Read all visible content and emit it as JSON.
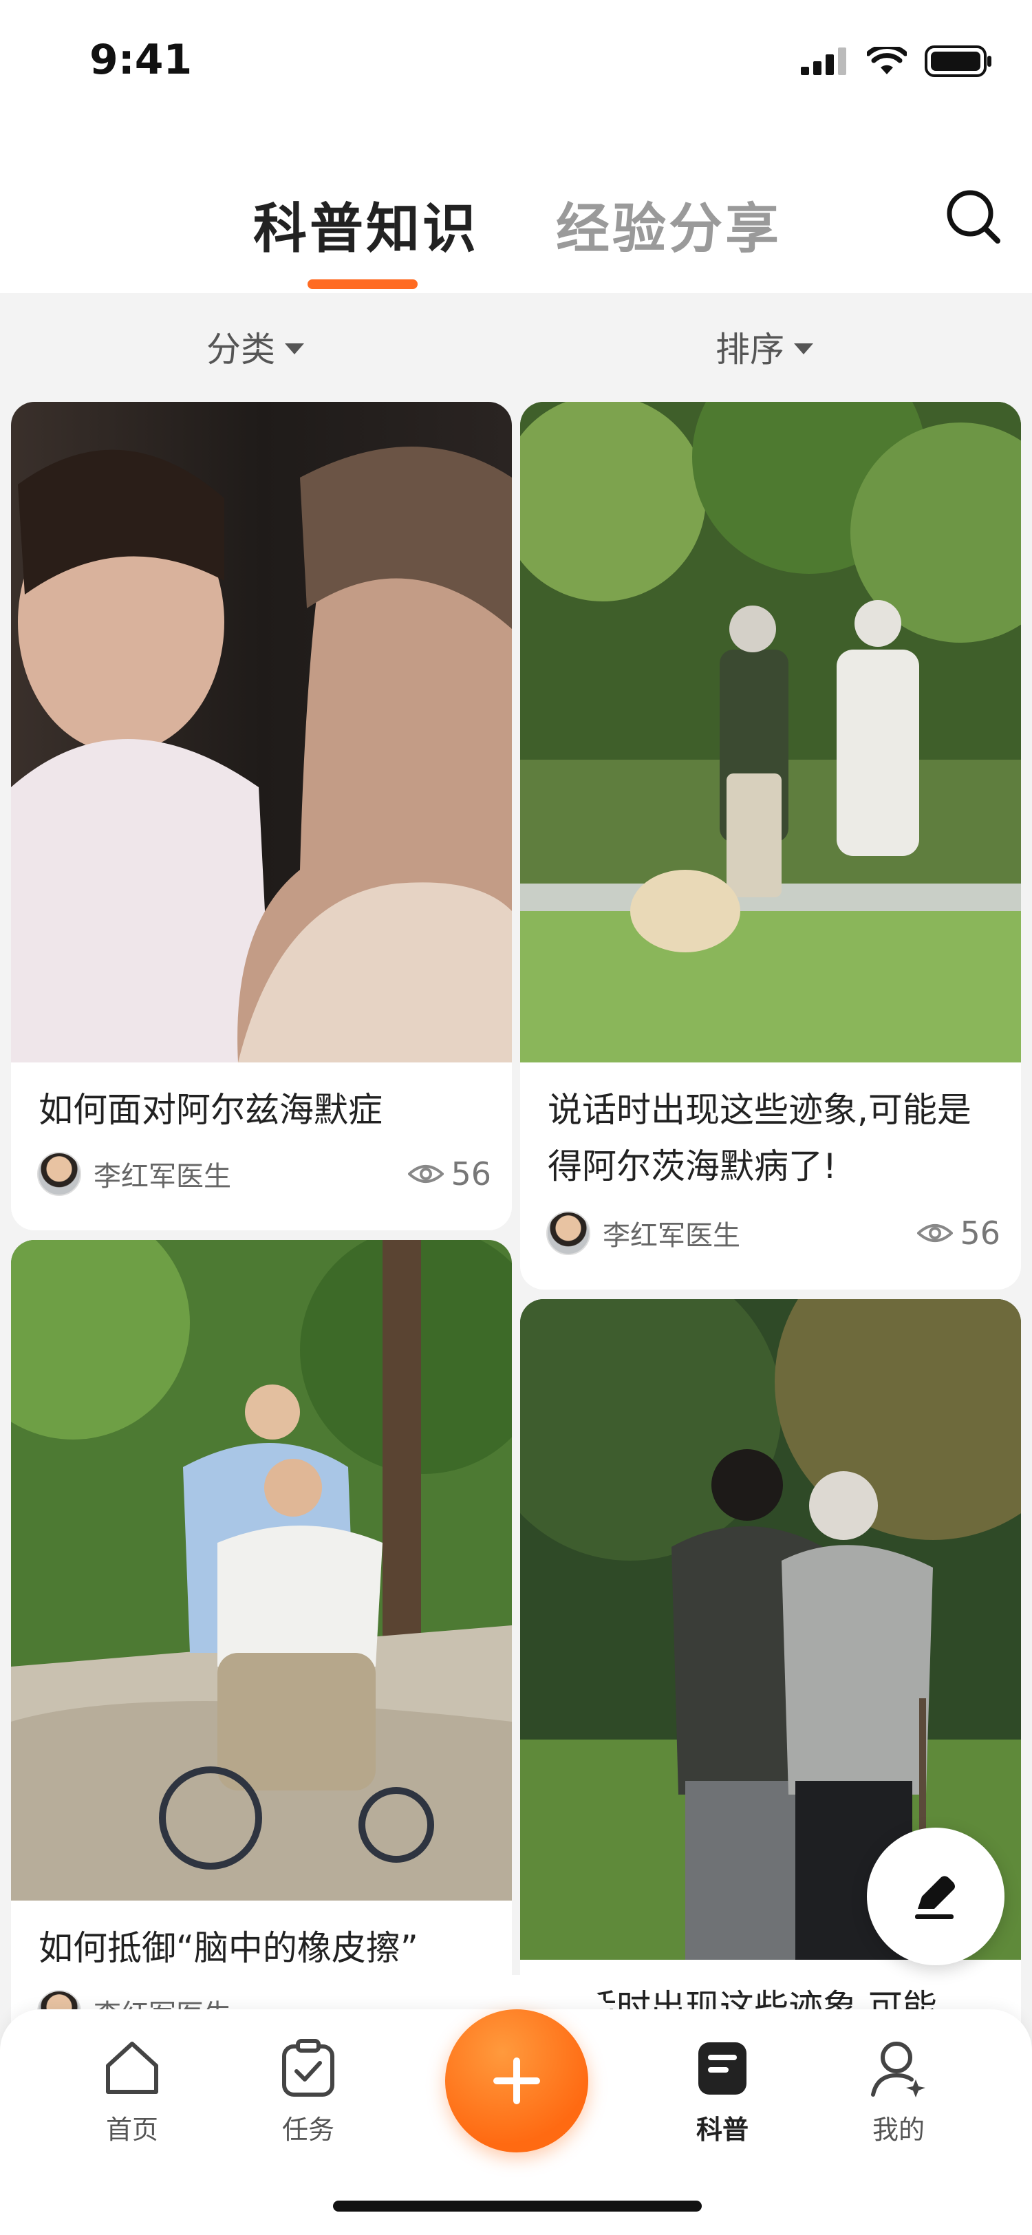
{
  "status_bar": {
    "time": "9:41",
    "icons": [
      "signal-icon",
      "wifi-icon",
      "battery-icon"
    ]
  },
  "header": {
    "tabs": [
      {
        "label": "科普知识",
        "active": true
      },
      {
        "label": "经验分享",
        "active": false
      }
    ],
    "search_icon": "search-icon"
  },
  "filters": {
    "category": "分类",
    "sort": "排序"
  },
  "cards": [
    {
      "title": "如何面对阿尔兹海默症",
      "author": "李红军医生",
      "views": "56"
    },
    {
      "title": "说话时出现这些迹象,可能是得阿尔茨海默病了!",
      "author": "李红军医生",
      "views": "56"
    },
    {
      "title": "如何抵御“脑中的橡皮擦”",
      "author": "李红军医生",
      "views": ""
    },
    {
      "title": "说话时出现这些迹象,可能",
      "author": "",
      "views": ""
    }
  ],
  "floating": {
    "edit_icon": "pen-icon"
  },
  "bottom_nav": {
    "items": [
      {
        "label": "首页",
        "icon": "home-icon"
      },
      {
        "label": "任务",
        "icon": "task-icon"
      },
      {
        "label": "科普",
        "icon": "article-icon",
        "active": true
      },
      {
        "label": "我的",
        "icon": "user-icon"
      }
    ],
    "center_icon": "plus-icon"
  },
  "colors": {
    "accent": "#ff6b22",
    "text": "#222222",
    "muted": "#9a9a9a"
  }
}
